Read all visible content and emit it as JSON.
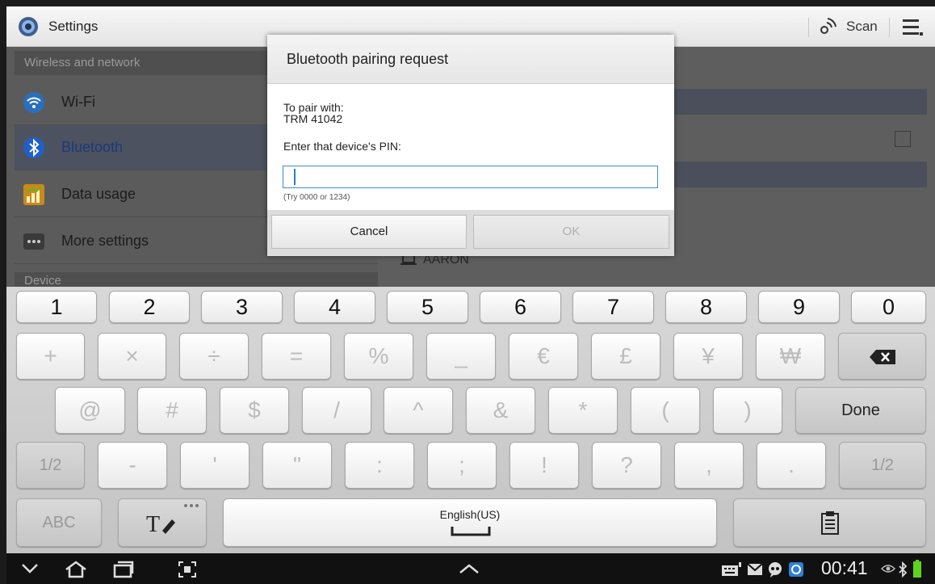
{
  "actionbar": {
    "title": "Settings",
    "scan_label": "Scan"
  },
  "settings": {
    "section_wireless": "Wireless and network",
    "items": [
      {
        "label": "Wi-Fi",
        "icon": "wifi-icon"
      },
      {
        "label": "Bluetooth",
        "icon": "bluetooth-icon"
      },
      {
        "label": "Data usage",
        "icon": "data-usage-icon"
      },
      {
        "label": "More settings",
        "icon": "more-icon"
      }
    ],
    "section_device": "Device"
  },
  "detail": {
    "device": "AARON"
  },
  "dialog": {
    "title": "Bluetooth pairing request",
    "pair_with": "To pair with:",
    "device_name": "TRM 41042",
    "pin_prompt": "Enter that device's PIN:",
    "pin_value": "",
    "pin_hint": "(Try 0000 or 1234)",
    "cancel_label": "Cancel",
    "ok_label": "OK"
  },
  "keyboard": {
    "row1": [
      "1",
      "2",
      "3",
      "4",
      "5",
      "6",
      "7",
      "8",
      "9",
      "0"
    ],
    "row2": [
      "+",
      "×",
      "÷",
      "=",
      "%",
      "_",
      "€",
      "£",
      "¥",
      "₩"
    ],
    "row3": [
      "@",
      "#",
      "$",
      "/",
      "^",
      "&",
      "*",
      "(",
      ")"
    ],
    "done_label": "Done",
    "row4_left": "1/2",
    "row4": [
      "-",
      "'",
      "\"",
      ":",
      ";",
      "!",
      "?",
      ",",
      "."
    ],
    "row4_right": "1/2",
    "abc_label": "ABC",
    "space_label": "English(US)"
  },
  "status": {
    "time": "00:41"
  },
  "colors": {
    "accent_blue": "#3d8bd6",
    "bluetooth_blue": "#1e60c8"
  }
}
